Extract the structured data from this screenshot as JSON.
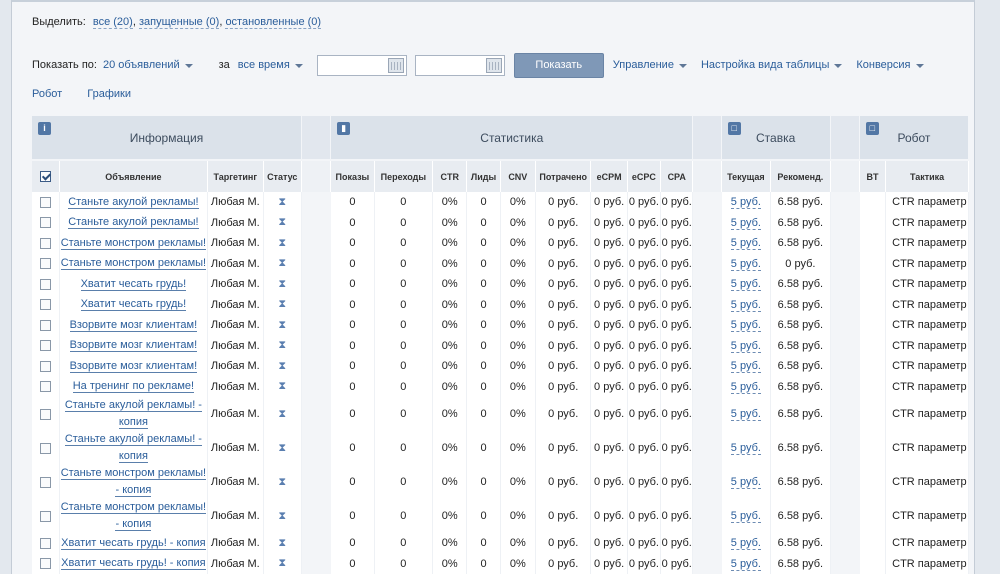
{
  "select": {
    "label": "Выделить:",
    "all": "все (20)",
    "running": "запущенные (0)",
    "stopped": "остановленные (0)"
  },
  "controls": {
    "show_by_label": "Показать по:",
    "show_by_value": "20 объявлений",
    "period_label": "за",
    "period_value": "все время",
    "date_from": "",
    "date_to": "",
    "show_button": "Показать",
    "manage": "Управление",
    "table_settings": "Настройка вида таблицы",
    "conversion": "Конверсия",
    "robot_link": "Робот",
    "charts_link": "Графики"
  },
  "groups": {
    "info": "Информация",
    "stats": "Статистика",
    "bid": "Ставка",
    "robot": "Робот"
  },
  "columns": {
    "ad": "Объявление",
    "targeting": "Таргетинг",
    "status": "Статус",
    "impressions": "Показы",
    "clicks": "Переходы",
    "ctr": "CTR",
    "leads": "Лиды",
    "cnv": "CNV",
    "spent": "Потрачено",
    "ecpm": "eCPM",
    "ecpc": "eCPC",
    "cpa": "CPA",
    "current": "Текущая",
    "recommended": "Рекоменд.",
    "bt": "BT",
    "tactic": "Тактика"
  },
  "rows": [
    {
      "ad": "Станьте акулой рекламы!",
      "targeting": "Любая М.",
      "impressions": "0",
      "clicks": "0",
      "ctr": "0%",
      "leads": "0",
      "cnv": "0%",
      "spent": "0 руб.",
      "ecpm": "0 руб.",
      "ecpc": "0 руб.",
      "cpa": "0 руб.",
      "current": "5 руб.",
      "recommended": "6.58 руб.",
      "bt": "",
      "tactic": "CTR параметр",
      "tall": false
    },
    {
      "ad": "Станьте акулой рекламы!",
      "targeting": "Любая М.",
      "impressions": "0",
      "clicks": "0",
      "ctr": "0%",
      "leads": "0",
      "cnv": "0%",
      "spent": "0 руб.",
      "ecpm": "0 руб.",
      "ecpc": "0 руб.",
      "cpa": "0 руб.",
      "current": "5 руб.",
      "recommended": "6.58 руб.",
      "bt": "",
      "tactic": "CTR параметр",
      "tall": false
    },
    {
      "ad": "Станьте монстром рекламы!",
      "targeting": "Любая М.",
      "impressions": "0",
      "clicks": "0",
      "ctr": "0%",
      "leads": "0",
      "cnv": "0%",
      "spent": "0 руб.",
      "ecpm": "0 руб.",
      "ecpc": "0 руб.",
      "cpa": "0 руб.",
      "current": "5 руб.",
      "recommended": "6.58 руб.",
      "bt": "",
      "tactic": "CTR параметр",
      "tall": false
    },
    {
      "ad": "Станьте монстром рекламы!",
      "targeting": "Любая М.",
      "impressions": "0",
      "clicks": "0",
      "ctr": "0%",
      "leads": "0",
      "cnv": "0%",
      "spent": "0 руб.",
      "ecpm": "0 руб.",
      "ecpc": "0 руб.",
      "cpa": "0 руб.",
      "current": "5 руб.",
      "recommended": "0 руб.",
      "bt": "",
      "tactic": "CTR параметр",
      "tall": false
    },
    {
      "ad": "Хватит чесать грудь!",
      "targeting": "Любая М.",
      "impressions": "0",
      "clicks": "0",
      "ctr": "0%",
      "leads": "0",
      "cnv": "0%",
      "spent": "0 руб.",
      "ecpm": "0 руб.",
      "ecpc": "0 руб.",
      "cpa": "0 руб.",
      "current": "5 руб.",
      "recommended": "6.58 руб.",
      "bt": "",
      "tactic": "CTR параметр",
      "tall": false
    },
    {
      "ad": "Хватит чесать грудь!",
      "targeting": "Любая М.",
      "impressions": "0",
      "clicks": "0",
      "ctr": "0%",
      "leads": "0",
      "cnv": "0%",
      "spent": "0 руб.",
      "ecpm": "0 руб.",
      "ecpc": "0 руб.",
      "cpa": "0 руб.",
      "current": "5 руб.",
      "recommended": "6.58 руб.",
      "bt": "",
      "tactic": "CTR параметр",
      "tall": false
    },
    {
      "ad": "Взорвите мозг клиентам!",
      "targeting": "Любая М.",
      "impressions": "0",
      "clicks": "0",
      "ctr": "0%",
      "leads": "0",
      "cnv": "0%",
      "spent": "0 руб.",
      "ecpm": "0 руб.",
      "ecpc": "0 руб.",
      "cpa": "0 руб.",
      "current": "5 руб.",
      "recommended": "6.58 руб.",
      "bt": "",
      "tactic": "CTR параметр",
      "tall": false
    },
    {
      "ad": "Взорвите мозг клиентам!",
      "targeting": "Любая М.",
      "impressions": "0",
      "clicks": "0",
      "ctr": "0%",
      "leads": "0",
      "cnv": "0%",
      "spent": "0 руб.",
      "ecpm": "0 руб.",
      "ecpc": "0 руб.",
      "cpa": "0 руб.",
      "current": "5 руб.",
      "recommended": "6.58 руб.",
      "bt": "",
      "tactic": "CTR параметр",
      "tall": false
    },
    {
      "ad": "Взорвите мозг клиентам!",
      "targeting": "Любая М.",
      "impressions": "0",
      "clicks": "0",
      "ctr": "0%",
      "leads": "0",
      "cnv": "0%",
      "spent": "0 руб.",
      "ecpm": "0 руб.",
      "ecpc": "0 руб.",
      "cpa": "0 руб.",
      "current": "5 руб.",
      "recommended": "6.58 руб.",
      "bt": "",
      "tactic": "CTR параметр",
      "tall": false
    },
    {
      "ad": "На тренинг по рекламе!",
      "targeting": "Любая М.",
      "impressions": "0",
      "clicks": "0",
      "ctr": "0%",
      "leads": "0",
      "cnv": "0%",
      "spent": "0 руб.",
      "ecpm": "0 руб.",
      "ecpc": "0 руб.",
      "cpa": "0 руб.",
      "current": "5 руб.",
      "recommended": "6.58 руб.",
      "bt": "",
      "tactic": "CTR параметр",
      "tall": false
    },
    {
      "ad": "Станьте акулой рекламы! - копия",
      "targeting": "Любая М.",
      "impressions": "0",
      "clicks": "0",
      "ctr": "0%",
      "leads": "0",
      "cnv": "0%",
      "spent": "0 руб.",
      "ecpm": "0 руб.",
      "ecpc": "0 руб.",
      "cpa": "0 руб.",
      "current": "5 руб.",
      "recommended": "6.58 руб.",
      "bt": "",
      "tactic": "CTR параметр",
      "tall": true
    },
    {
      "ad": "Станьте акулой рекламы! - копия",
      "targeting": "Любая М.",
      "impressions": "0",
      "clicks": "0",
      "ctr": "0%",
      "leads": "0",
      "cnv": "0%",
      "spent": "0 руб.",
      "ecpm": "0 руб.",
      "ecpc": "0 руб.",
      "cpa": "0 руб.",
      "current": "5 руб.",
      "recommended": "6.58 руб.",
      "bt": "",
      "tactic": "CTR параметр",
      "tall": true
    },
    {
      "ad": "Станьте монстром рекламы! - копия",
      "targeting": "Любая М.",
      "impressions": "0",
      "clicks": "0",
      "ctr": "0%",
      "leads": "0",
      "cnv": "0%",
      "spent": "0 руб.",
      "ecpm": "0 руб.",
      "ecpc": "0 руб.",
      "cpa": "0 руб.",
      "current": "5 руб.",
      "recommended": "6.58 руб.",
      "bt": "",
      "tactic": "CTR параметр",
      "tall": true
    },
    {
      "ad": "Станьте монстром рекламы! - копия",
      "targeting": "Любая М.",
      "impressions": "0",
      "clicks": "0",
      "ctr": "0%",
      "leads": "0",
      "cnv": "0%",
      "spent": "0 руб.",
      "ecpm": "0 руб.",
      "ecpc": "0 руб.",
      "cpa": "0 руб.",
      "current": "5 руб.",
      "recommended": "6.58 руб.",
      "bt": "",
      "tactic": "CTR параметр",
      "tall": true
    },
    {
      "ad": "Хватит чесать грудь! - копия",
      "targeting": "Любая М.",
      "impressions": "0",
      "clicks": "0",
      "ctr": "0%",
      "leads": "0",
      "cnv": "0%",
      "spent": "0 руб.",
      "ecpm": "0 руб.",
      "ecpc": "0 руб.",
      "cpa": "0 руб.",
      "current": "5 руб.",
      "recommended": "6.58 руб.",
      "bt": "",
      "tactic": "CTR параметр",
      "tall": false
    },
    {
      "ad": "Хватит чесать грудь! - копия",
      "targeting": "Любая М.",
      "impressions": "0",
      "clicks": "0",
      "ctr": "0%",
      "leads": "0",
      "cnv": "0%",
      "spent": "0 руб.",
      "ecpm": "0 руб.",
      "ecpc": "0 руб.",
      "cpa": "0 руб.",
      "current": "5 руб.",
      "recommended": "6.58 руб.",
      "bt": "",
      "tactic": "CTR параметр",
      "tall": false
    }
  ],
  "status_icon": "hourglass-icon"
}
